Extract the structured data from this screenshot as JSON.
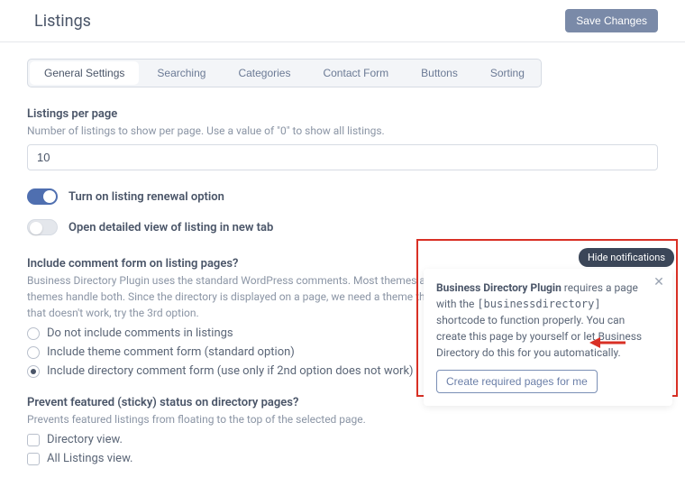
{
  "header": {
    "title": "Listings",
    "save_label": "Save Changes"
  },
  "tabs": [
    {
      "label": "General Settings",
      "active": true
    },
    {
      "label": "Searching",
      "active": false
    },
    {
      "label": "Categories",
      "active": false
    },
    {
      "label": "Contact Form",
      "active": false
    },
    {
      "label": "Buttons",
      "active": false
    },
    {
      "label": "Sorting",
      "active": false
    }
  ],
  "listings_per_page": {
    "label": "Listings per page",
    "desc": "Number of listings to show per page. Use a value of \"0\" to show all listings.",
    "value": "10"
  },
  "toggle_renewal": {
    "label": "Turn on listing renewal option",
    "on": true
  },
  "toggle_newtab": {
    "label": "Open detailed view of listing in new tab",
    "on": false
  },
  "comment_form": {
    "heading": "Include comment form on listing pages?",
    "desc": "Business Directory Plugin uses the standard WordPress comments. Most themes allow for comments on posts, not pages. Some themes handle both. Since the directory is displayed on a page, we need a theme that can handle both. Use the 2nd option first, if that doesn't work, try the 3rd option.",
    "options": [
      {
        "label": "Do not include comments in listings",
        "selected": false
      },
      {
        "label": "Include theme comment form (standard option)",
        "selected": false
      },
      {
        "label": "Include directory comment form (use only if 2nd option does not work)",
        "selected": true
      }
    ]
  },
  "sticky": {
    "heading": "Prevent featured (sticky) status on directory pages?",
    "desc": "Prevents featured listings from floating to the top of the selected page.",
    "options": [
      {
        "label": "Directory view."
      },
      {
        "label": "All Listings view."
      }
    ]
  },
  "notification": {
    "hide_label": "Hide notifications",
    "title_strong": "Business Directory Plugin",
    "text_1": " requires a page with the ",
    "shortcode": "[businessdirectory]",
    "text_2": " shortcode to function properly. You can create this page by yourself or let Business Directory do this for you automatically.",
    "button_label": "Create required pages for me"
  }
}
